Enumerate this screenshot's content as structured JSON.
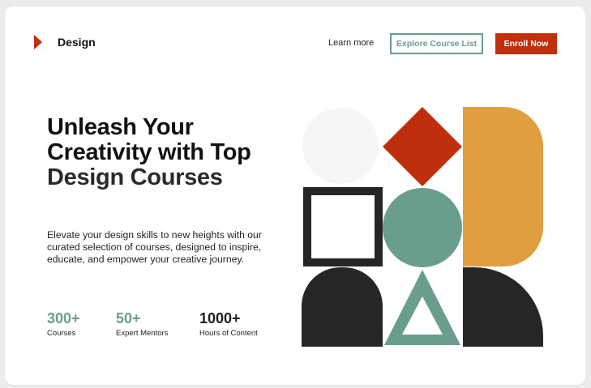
{
  "header": {
    "logo_text": "Design",
    "nav_link": "Learn more",
    "explore_button": "Explore Course List",
    "enroll_button": "Enroll Now"
  },
  "hero": {
    "title_part1": "Unleash Your Creativity with Top ",
    "title_accent": "Design Courses",
    "description": "Elevate your design skills to new heights with our curated selection of courses, designed to inspire, educate, and empower your creative journey."
  },
  "stats": [
    {
      "value": "300+",
      "label": "Courses",
      "color": "#6a9e8c"
    },
    {
      "value": "50+",
      "label": "Expert Mentors",
      "color": "#6a9e8c"
    },
    {
      "value": "1000+",
      "label": "Hours of Content",
      "color": "#1e1e1e"
    }
  ],
  "colors": {
    "brand_red": "#c0300c",
    "teal": "#6a9e8c",
    "orange": "#e09e3e",
    "dark": "#262626"
  }
}
